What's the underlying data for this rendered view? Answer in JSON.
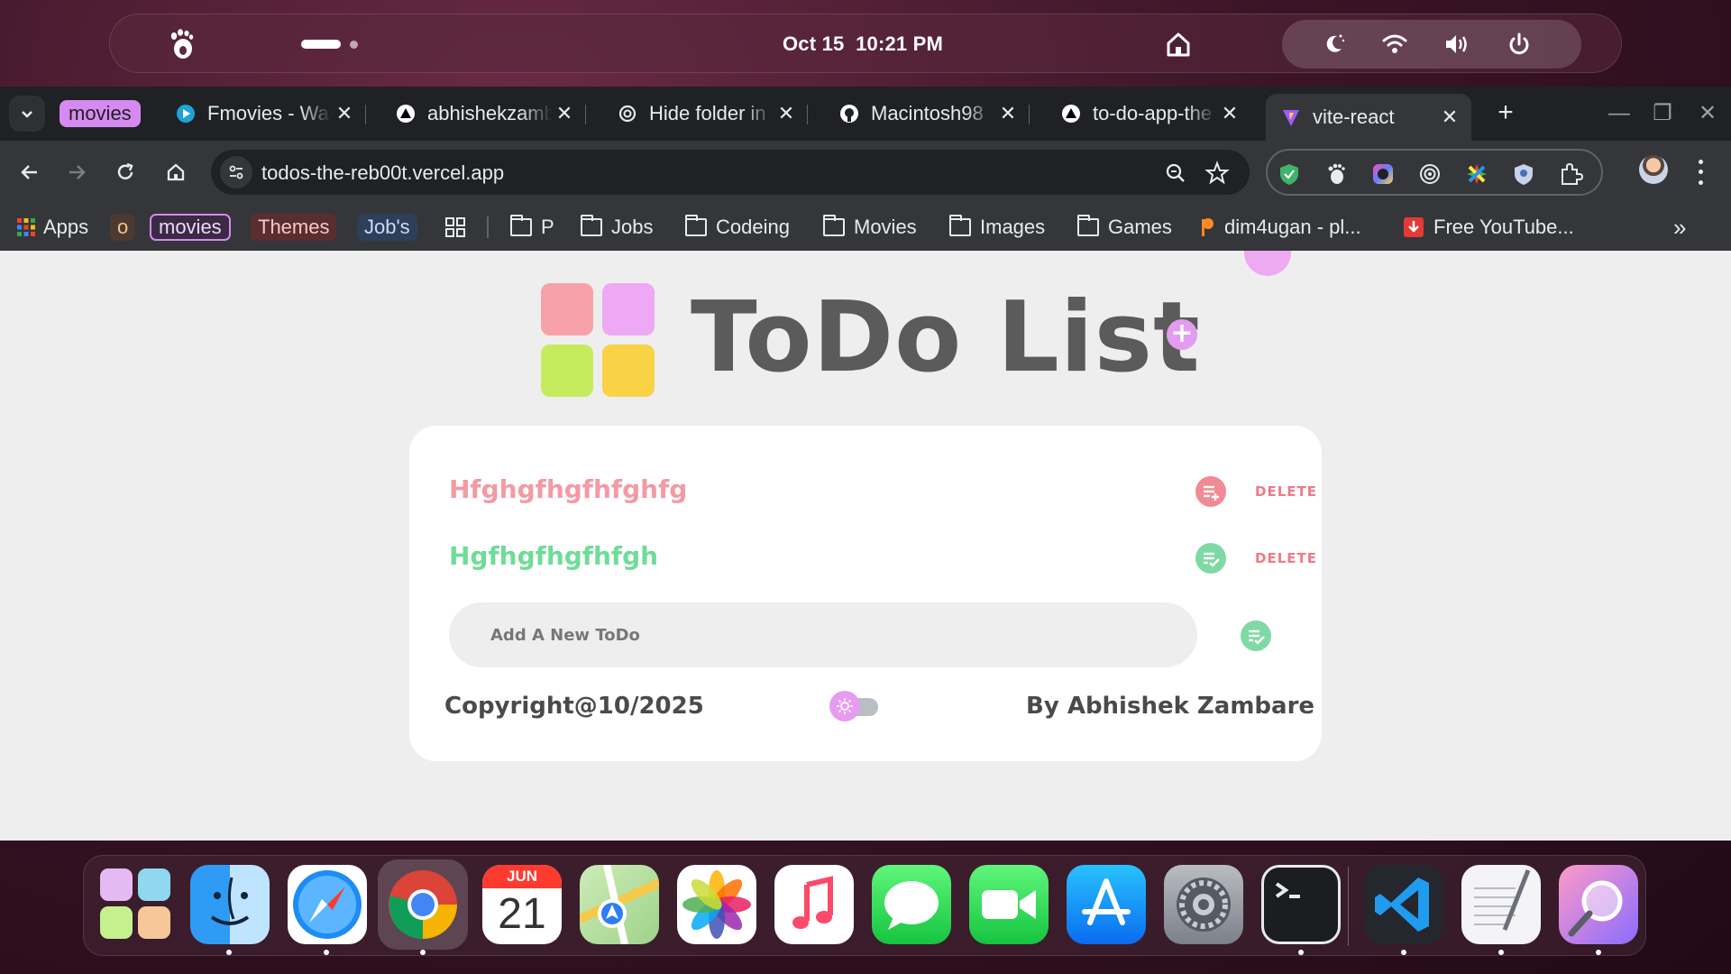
{
  "shell": {
    "clock_date": "Oct 15",
    "clock_time": "10:21 PM"
  },
  "browser": {
    "tab_group_label": "movies",
    "tabs": [
      {
        "title": "Fmovies - Watch",
        "favicon": "play-icon"
      },
      {
        "title": "abhishekzambare",
        "favicon": "vercel-icon"
      },
      {
        "title": "Hide folder in",
        "favicon": "chatgpt-icon"
      },
      {
        "title": "Macintosh98",
        "favicon": "github-icon"
      },
      {
        "title": "to-do-app-the",
        "favicon": "vercel-icon"
      },
      {
        "title": "vite-react",
        "favicon": "vite-icon",
        "active": true
      }
    ],
    "url": "todos-the-reb00t.vercel.app",
    "bookmarks": {
      "apps": "Apps",
      "o": "o",
      "movies": "movies",
      "themes": "Themes",
      "jobs_chip": "Job's",
      "folders": [
        "P",
        "Jobs",
        "Codeing",
        "Movies",
        "Images",
        "Games"
      ],
      "link1": "dim4ugan - pl...",
      "link2": "Free YouTube...",
      "overflow": "»"
    }
  },
  "app": {
    "title": "ToDo List",
    "todos": [
      {
        "text": "Hfghgfhgfhfghfg",
        "color": "#f39aa4",
        "edit_color": "#f08a94",
        "delete_label": "DELETE"
      },
      {
        "text": "Hgfhgfhgfhfgh",
        "color": "#6fdc98",
        "edit_color": "#7fd9a4",
        "delete_label": "DELETE"
      }
    ],
    "new_todo_placeholder": "Add A New ToDo",
    "footer_left": "Copyright@10/2025",
    "footer_right": "By Abhishek Zambare",
    "accent_pink": "#e39cf0",
    "logo_colors": [
      "#f7a1aa",
      "#eea8f4",
      "#c5ec5d",
      "#f9d246"
    ]
  },
  "dock": {
    "apps": [
      "Launchpad",
      "Finder",
      "Safari",
      "Chrome",
      "Calendar",
      "Maps",
      "Photos",
      "Music",
      "Messages",
      "FaceTime",
      "App Store",
      "System Settings",
      "Terminal",
      "VS Code",
      "TextEdit",
      "Preview"
    ],
    "calendar_month": "JUN",
    "calendar_day": "21"
  }
}
